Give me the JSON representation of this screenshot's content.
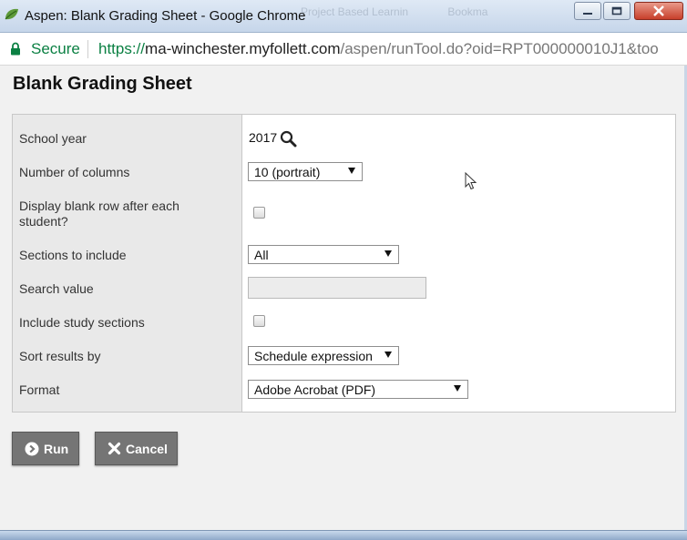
{
  "window": {
    "title": "Aspen: Blank Grading Sheet - Google Chrome",
    "background_tabs": [
      "Project Based Learnin",
      "Bookma"
    ],
    "controls": {
      "minimize": "minimize",
      "maximize": "maximize",
      "close": "close"
    }
  },
  "address_bar": {
    "secure_label": "Secure",
    "url_scheme": "https://",
    "url_host": "ma-winchester.myfollett.com",
    "url_path": "/aspen/runTool.do?oid=RPT000000010J1&too"
  },
  "page": {
    "title": "Blank Grading Sheet"
  },
  "form": {
    "school_year": {
      "label": "School year",
      "value": "2017"
    },
    "number_of_columns": {
      "label": "Number of columns",
      "value": "10 (portrait)"
    },
    "display_blank_row": {
      "label": "Display blank row after each student?",
      "checked": false
    },
    "sections_to_include": {
      "label": "Sections to include",
      "value": "All"
    },
    "search_value": {
      "label": "Search value",
      "value": ""
    },
    "include_study_sections": {
      "label": "Include study sections",
      "checked": false
    },
    "sort_results_by": {
      "label": "Sort results by",
      "value": "Schedule expression"
    },
    "format": {
      "label": "Format",
      "value": "Adobe Acrobat (PDF)"
    }
  },
  "buttons": {
    "run": "Run",
    "cancel": "Cancel"
  },
  "icons": {
    "lock": "lock-icon",
    "search": "search-icon",
    "run": "play-circle-icon",
    "cancel": "close-icon"
  },
  "colors": {
    "secure_green": "#0b8043",
    "button_gray": "#757575",
    "label_column_bg": "#e9e9e9"
  }
}
